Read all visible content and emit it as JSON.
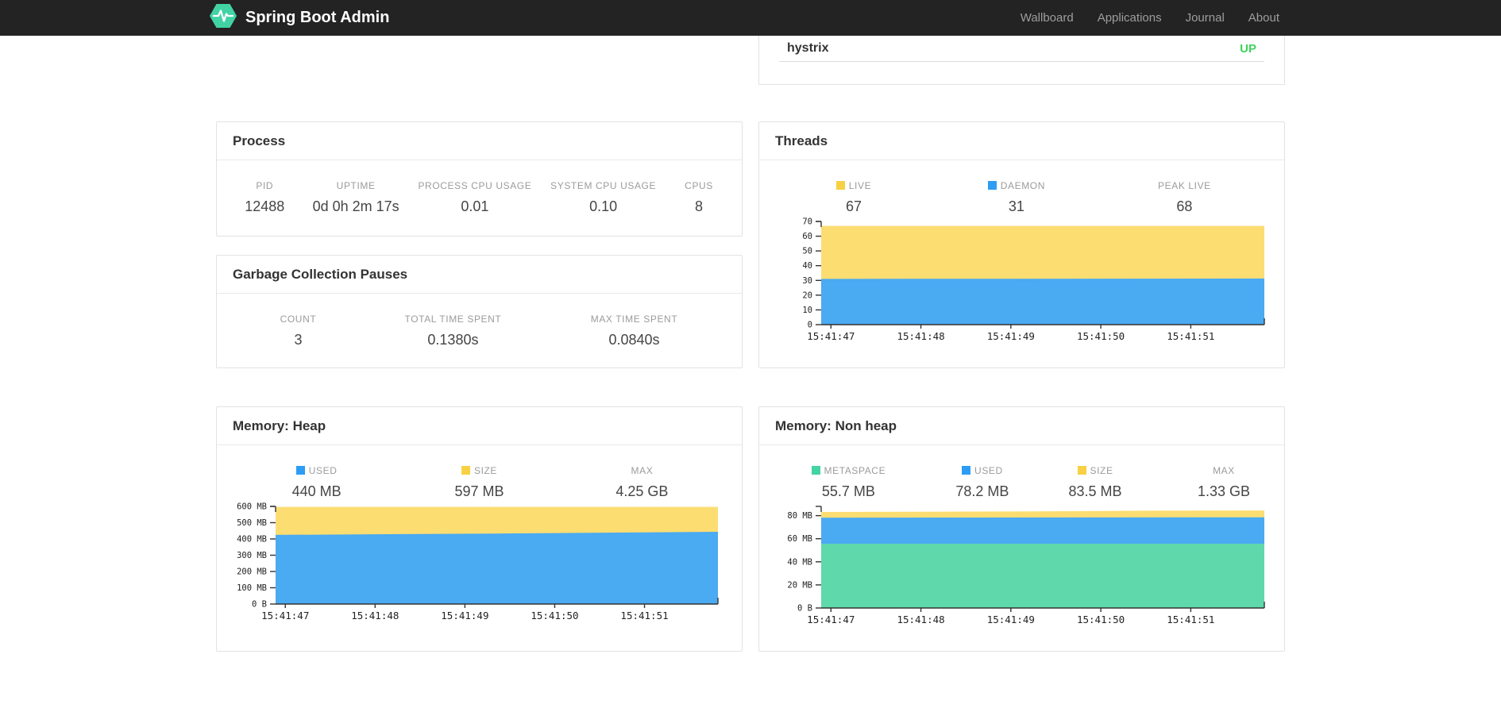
{
  "colors": {
    "navbar_bg": "#232323",
    "brand_green": "#42d3a5",
    "status_up": "#3ed35c",
    "nav_link": "#9d9d9d",
    "area_yellow": "#fcdd72",
    "area_blue": "#4aaaf2",
    "area_green": "#5fd9ab",
    "swatch_yellow": "#f7d143",
    "swatch_blue": "#2d9cf4",
    "swatch_green": "#43d3a5"
  },
  "navbar": {
    "brand": "Spring Boot Admin",
    "links": [
      {
        "label": "Wallboard"
      },
      {
        "label": "Applications"
      },
      {
        "label": "Journal"
      },
      {
        "label": "About"
      }
    ]
  },
  "applications": {
    "rows": [
      {
        "name": "hystrix",
        "status": "UP"
      }
    ]
  },
  "process": {
    "title": "Process",
    "metrics": [
      {
        "label": "PID",
        "value": "12488"
      },
      {
        "label": "UPTIME",
        "value": "0d 0h 2m 17s"
      },
      {
        "label": "PROCESS CPU USAGE",
        "value": "0.01"
      },
      {
        "label": "SYSTEM CPU USAGE",
        "value": "0.10"
      },
      {
        "label": "CPUS",
        "value": "8"
      }
    ]
  },
  "gc": {
    "title": "Garbage Collection Pauses",
    "metrics": [
      {
        "label": "COUNT",
        "value": "3"
      },
      {
        "label": "TOTAL TIME SPENT",
        "value": "0.1380s"
      },
      {
        "label": "MAX TIME SPENT",
        "value": "0.0840s"
      }
    ]
  },
  "threads": {
    "title": "Threads",
    "metrics": [
      {
        "label": "LIVE",
        "value": "67",
        "color": "#f7d143"
      },
      {
        "label": "DAEMON",
        "value": "31",
        "color": "#2d9cf4"
      },
      {
        "label": "PEAK LIVE",
        "value": "68"
      }
    ],
    "chart_data": {
      "type": "area",
      "stacked": true,
      "ymax": 70,
      "y_ticks": [
        {
          "label": "70",
          "value": 70
        },
        {
          "label": "60",
          "value": 60
        },
        {
          "label": "50",
          "value": 50
        },
        {
          "label": "40",
          "value": 40
        },
        {
          "label": "30",
          "value": 30
        },
        {
          "label": "20",
          "value": 20
        },
        {
          "label": "10",
          "value": 10
        },
        {
          "label": "0",
          "value": 0
        }
      ],
      "x_ticks": {
        "labels": [
          "15:41:47",
          "15:41:48",
          "15:41:49",
          "15:41:50",
          "15:41:51"
        ],
        "fractions": [
          0.022,
          0.225,
          0.428,
          0.631,
          0.834
        ]
      },
      "series": [
        {
          "name": "LIVE",
          "color": "#fcdd72",
          "tops": [
            [
              0,
              67
            ],
            [
              1,
              67
            ]
          ]
        },
        {
          "name": "DAEMON",
          "color": "#4aaaf2",
          "tops": [
            [
              0,
              31
            ],
            [
              1,
              31.3
            ]
          ]
        }
      ]
    }
  },
  "memory_heap": {
    "title": "Memory: Heap",
    "metrics": [
      {
        "label": "USED",
        "value": "440 MB",
        "color": "#2d9cf4"
      },
      {
        "label": "SIZE",
        "value": "597 MB",
        "color": "#f7d143"
      },
      {
        "label": "MAX",
        "value": "4.25 GB"
      }
    ],
    "chart_data": {
      "type": "area",
      "stacked": true,
      "ymax": 600,
      "y_ticks": [
        {
          "label": "600 MB",
          "value": 600
        },
        {
          "label": "500 MB",
          "value": 500
        },
        {
          "label": "400 MB",
          "value": 400
        },
        {
          "label": "300 MB",
          "value": 300
        },
        {
          "label": "200 MB",
          "value": 200
        },
        {
          "label": "100 MB",
          "value": 100
        },
        {
          "label": "0 B",
          "value": 0
        }
      ],
      "x_ticks": {
        "labels": [
          "15:41:47",
          "15:41:48",
          "15:41:49",
          "15:41:50",
          "15:41:51"
        ],
        "fractions": [
          0.022,
          0.225,
          0.428,
          0.631,
          0.834
        ]
      },
      "series": [
        {
          "name": "SIZE",
          "color": "#fcdd72",
          "tops": [
            [
              0,
              597
            ],
            [
              1,
              597
            ]
          ]
        },
        {
          "name": "USED",
          "color": "#4aaaf2",
          "tops": [
            [
              0,
              425
            ],
            [
              0.5,
              433
            ],
            [
              1,
              444
            ]
          ]
        }
      ]
    }
  },
  "memory_nonheap": {
    "title": "Memory: Non heap",
    "metrics": [
      {
        "label": "METASPACE",
        "value": "55.7 MB",
        "color": "#43d3a5"
      },
      {
        "label": "USED",
        "value": "78.2 MB",
        "color": "#2d9cf4"
      },
      {
        "label": "SIZE",
        "value": "83.5 MB",
        "color": "#f7d143"
      },
      {
        "label": "MAX",
        "value": "1.33 GB"
      }
    ],
    "chart_data": {
      "type": "area",
      "stacked": true,
      "ymax": 88,
      "y_ticks": [
        {
          "label": "80 MB",
          "value": 80
        },
        {
          "label": "60 MB",
          "value": 60
        },
        {
          "label": "40 MB",
          "value": 40
        },
        {
          "label": "20 MB",
          "value": 20
        },
        {
          "label": "0 B",
          "value": 0
        }
      ],
      "x_ticks": {
        "labels": [
          "15:41:47",
          "15:41:48",
          "15:41:49",
          "15:41:50",
          "15:41:51"
        ],
        "fractions": [
          0.022,
          0.225,
          0.428,
          0.631,
          0.834
        ]
      },
      "series": [
        {
          "name": "SIZE",
          "color": "#fcdd72",
          "tops": [
            [
              0,
              83.2
            ],
            [
              0.45,
              83.6
            ],
            [
              0.75,
              84.3
            ],
            [
              1,
              84.5
            ]
          ]
        },
        {
          "name": "USED",
          "color": "#4aaaf2",
          "tops": [
            [
              0,
              78.2
            ],
            [
              1,
              78.6
            ]
          ]
        },
        {
          "name": "METASPACE",
          "color": "#5fd9ab",
          "tops": [
            [
              0,
              55.7
            ],
            [
              1,
              55.7
            ]
          ]
        }
      ]
    }
  }
}
